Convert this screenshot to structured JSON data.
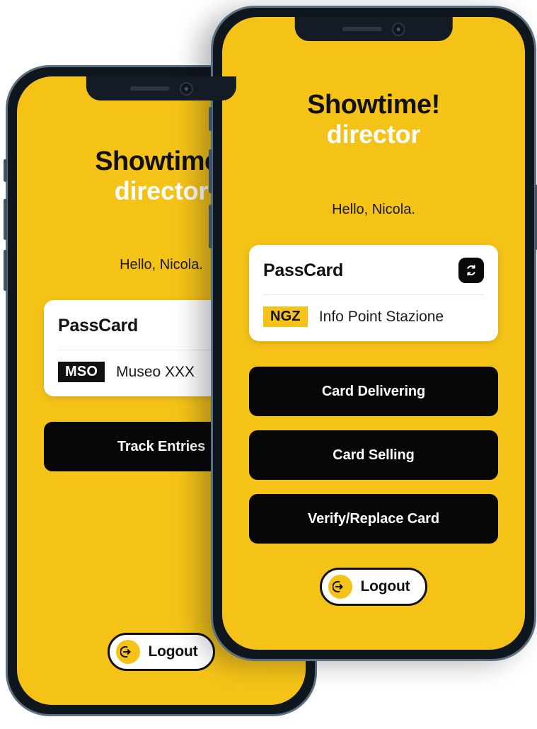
{
  "colors": {
    "brand_yellow": "#F5C318",
    "ink": "#111111",
    "button_black": "#070707",
    "card_white": "#FFFFFF",
    "phone_body": "#0F161E",
    "phone_rim": "#5D7080"
  },
  "back_phone": {
    "brand": {
      "line1": "Showtime!",
      "line2": "director"
    },
    "greeting": "Hello, Nicola.",
    "passcard": {
      "title": "PassCard",
      "swap_icon": "swap-refresh-icon",
      "badge": "MSO",
      "badge_style": "dark",
      "venue": "Museo XXX"
    },
    "actions": [
      {
        "label": "Track Entries"
      }
    ],
    "logout": {
      "label": "Logout",
      "icon": "logout-arrow-icon"
    }
  },
  "front_phone": {
    "brand": {
      "line1": "Showtime!",
      "line2": "director"
    },
    "greeting": "Hello, Nicola.",
    "passcard": {
      "title": "PassCard",
      "swap_icon": "swap-refresh-icon",
      "badge": "NGZ",
      "badge_style": "yellow",
      "venue": "Info Point Stazione"
    },
    "actions": [
      {
        "label": "Card Delivering"
      },
      {
        "label": "Card Selling"
      },
      {
        "label": "Verify/Replace Card"
      }
    ],
    "logout": {
      "label": "Logout",
      "icon": "logout-arrow-icon"
    }
  }
}
